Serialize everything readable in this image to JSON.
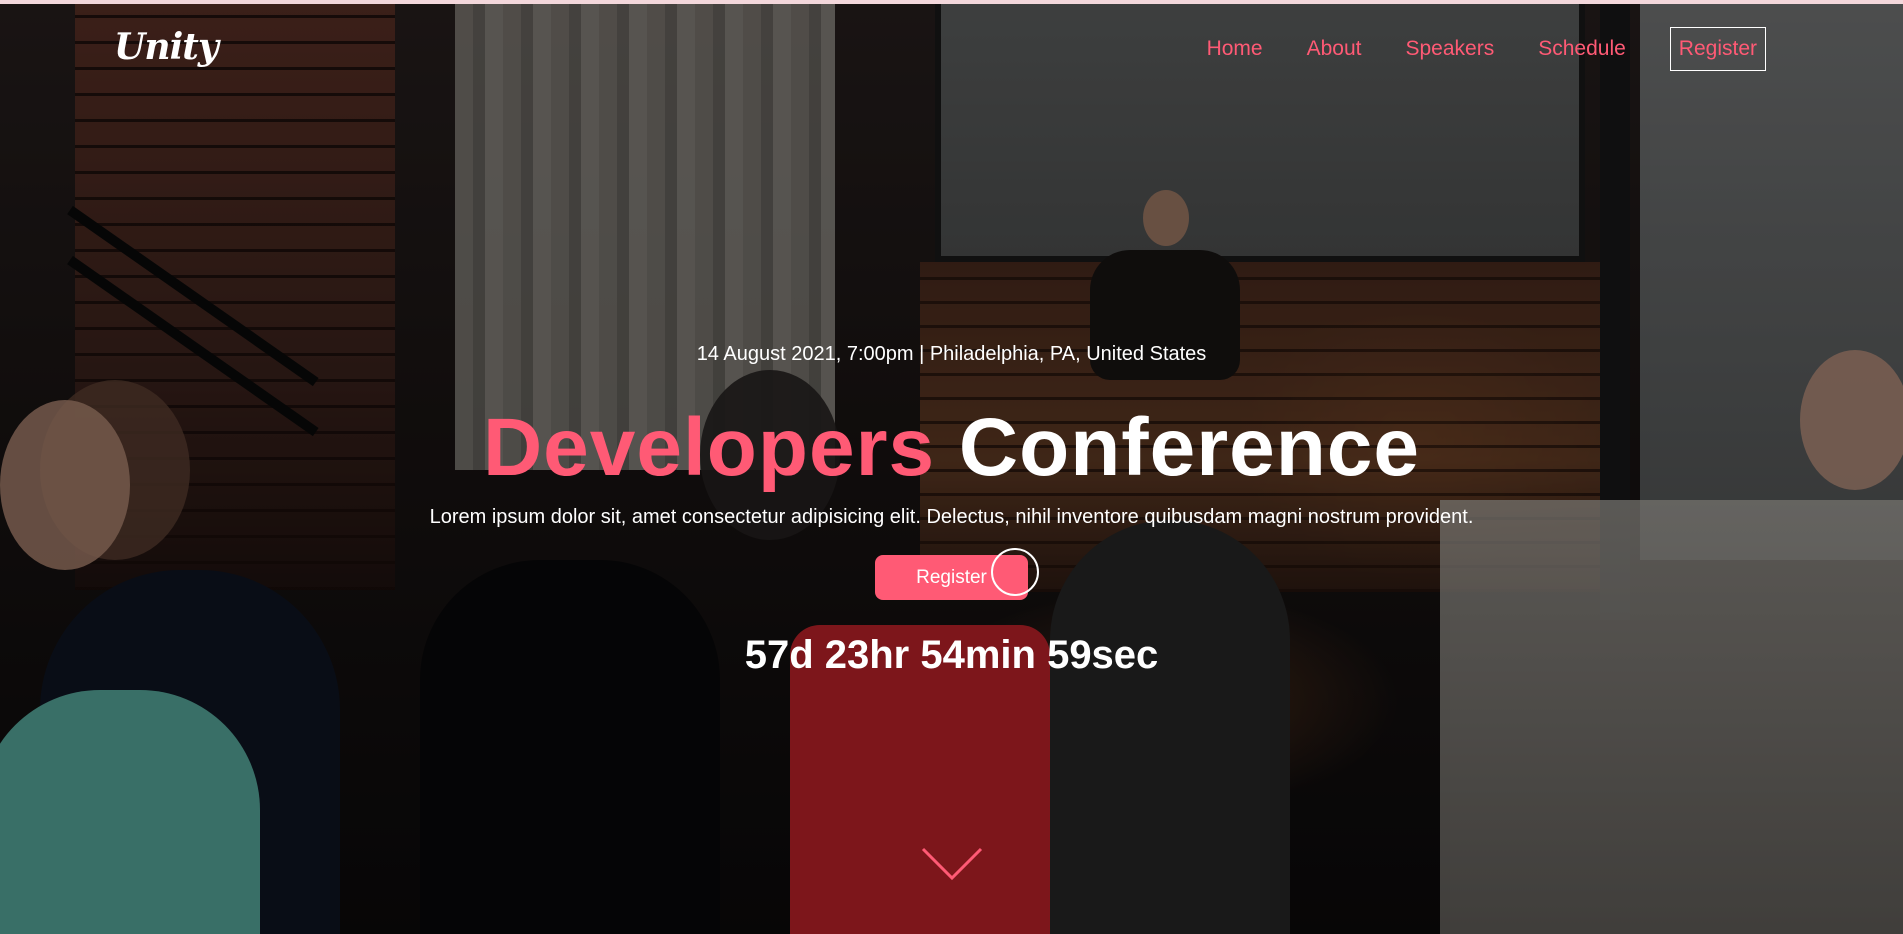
{
  "brand": {
    "logo_text": "Unity"
  },
  "nav": {
    "links": [
      {
        "label": "Home"
      },
      {
        "label": "About"
      },
      {
        "label": "Speakers"
      },
      {
        "label": "Schedule"
      }
    ],
    "register_label": "Register"
  },
  "hero": {
    "event_meta": "14 August 2021, 7:00pm | Philadelphia, PA, United States",
    "headline_accent": "Developers",
    "headline_rest": "Conference",
    "tagline": "Lorem ipsum dolor sit, amet consectetur adipisicing elit. Delectus, nihil inventore quibusdam magni nostrum provident.",
    "cta_label": "Register",
    "countdown": "57d 23hr 54min 59sec",
    "scroll_icon": "chevron-down-icon"
  },
  "colors": {
    "accent": "#ff5a75",
    "text": "#ffffff",
    "overlay": "rgba(0,0,0,0.42)"
  }
}
